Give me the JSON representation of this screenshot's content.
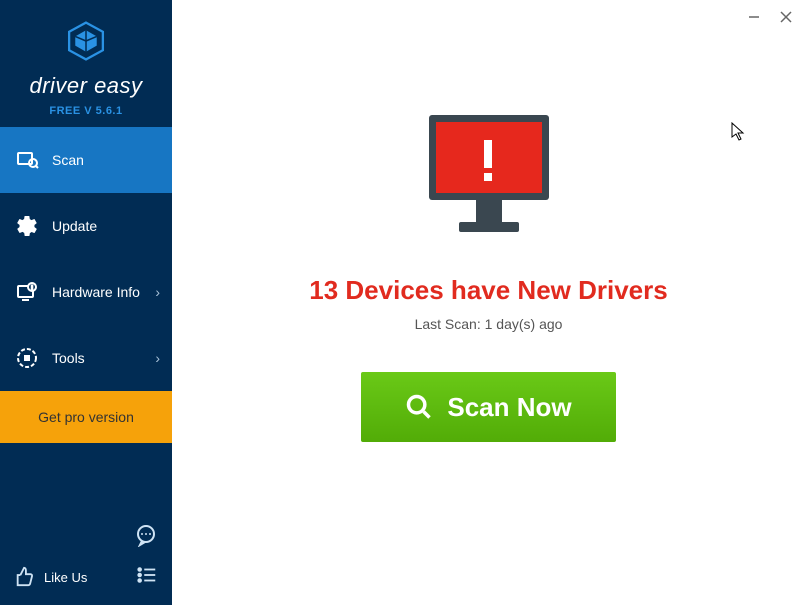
{
  "app": {
    "brand": "driver easy",
    "version": "FREE V 5.6.1"
  },
  "sidebar": {
    "items": [
      {
        "label": "Scan",
        "icon": "scan-icon",
        "active": true,
        "hasSubmenu": false
      },
      {
        "label": "Update",
        "icon": "gear-icon",
        "active": false,
        "hasSubmenu": false
      },
      {
        "label": "Hardware Info",
        "icon": "hardware-icon",
        "active": false,
        "hasSubmenu": true
      },
      {
        "label": "Tools",
        "icon": "tools-icon",
        "active": false,
        "hasSubmenu": true
      }
    ],
    "proButton": "Get pro version",
    "likeUs": "Like Us"
  },
  "main": {
    "headline": "13 Devices have New Drivers",
    "lastScan": "Last Scan: 1 day(s) ago",
    "scanButton": "Scan Now"
  },
  "colors": {
    "sidebarBg": "#012c54",
    "activeBg": "#1776c3",
    "proBg": "#f6a20a",
    "alertRed": "#e12b1f",
    "scanGreen": "#5eb90a"
  }
}
